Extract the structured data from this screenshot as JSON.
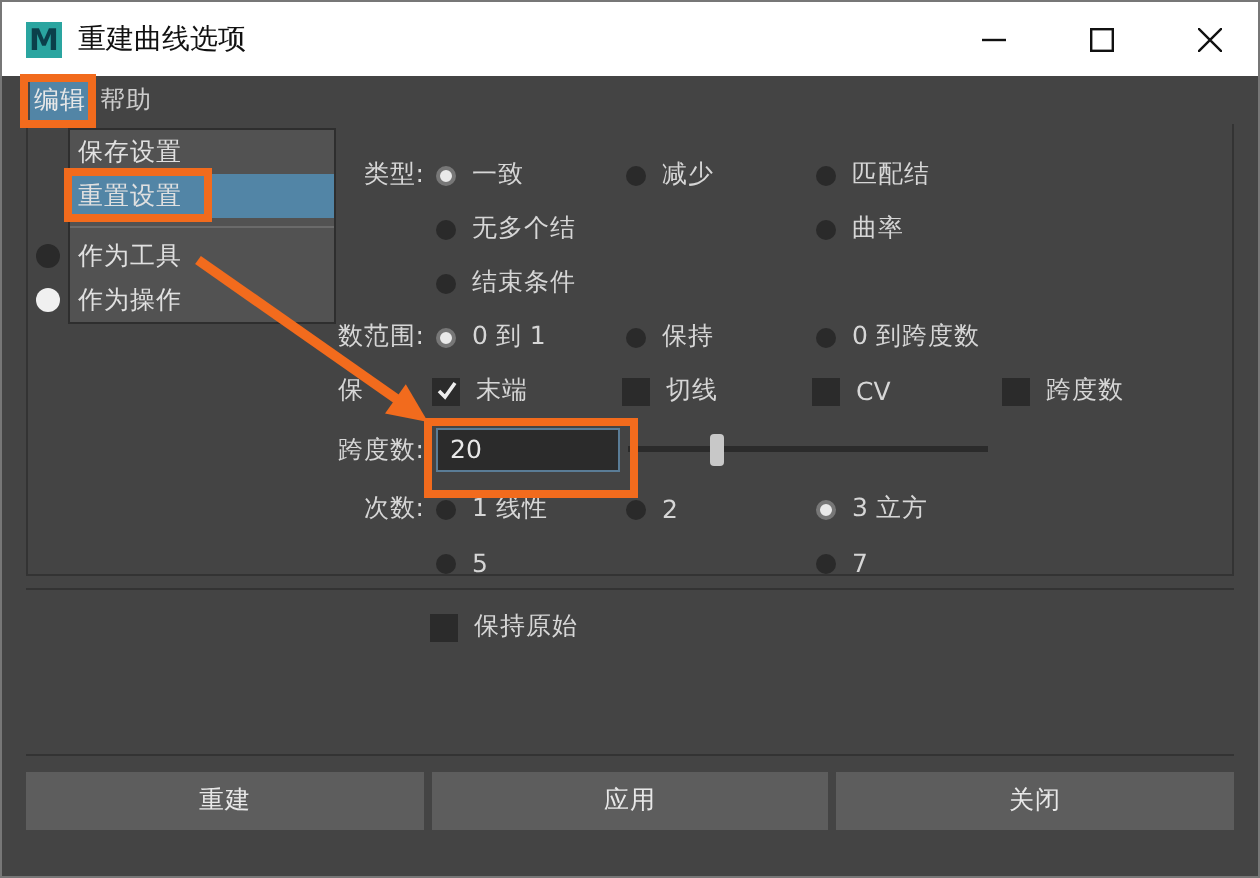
{
  "window": {
    "logo": "M",
    "title": "重建曲线选项"
  },
  "menu_bar": [
    {
      "label": "编辑",
      "selected": true
    },
    {
      "label": "帮助",
      "selected": false
    }
  ],
  "menu_dropdown": {
    "items": [
      {
        "kind": "item",
        "label": "保存设置",
        "selected": false
      },
      {
        "kind": "item",
        "label": "重置设置",
        "selected": true
      },
      {
        "kind": "separator"
      },
      {
        "kind": "radio",
        "label": "作为工具",
        "selected": false
      },
      {
        "kind": "radio",
        "label": "作为操作",
        "selected": true
      }
    ]
  },
  "form": {
    "rows": [
      {
        "kind": "radio",
        "label": "类型:",
        "columns": [
          [
            {
              "label": "一致",
              "selected": true
            },
            {
              "label": "无多个结",
              "selected": false
            },
            {
              "label": "结束条件",
              "selected": false
            }
          ],
          [
            {
              "label": "减少",
              "selected": false
            }
          ],
          [
            {
              "label": "匹配结",
              "selected": false
            },
            {
              "label": "曲率",
              "selected": false
            }
          ]
        ]
      },
      {
        "kind": "radio",
        "label": "数范围:",
        "columns": [
          [
            {
              "label": "0 到 1",
              "selected": true
            }
          ],
          [
            {
              "label": "保持",
              "selected": false
            }
          ],
          [
            {
              "label": "0 到跨度数",
              "selected": false
            }
          ]
        ]
      },
      {
        "kind": "check",
        "label": "保",
        "columns": [
          [
            {
              "label": "末端",
              "checked": true
            }
          ],
          [
            {
              "label": "切线",
              "checked": false
            }
          ],
          [
            {
              "label": "CV",
              "checked": false
            }
          ],
          [
            {
              "label": "跨度数",
              "checked": false
            }
          ]
        ]
      },
      {
        "kind": "slider",
        "label": "跨度数:",
        "value": "20",
        "level": 0.23
      },
      {
        "kind": "radio",
        "label": "次数:",
        "columns": [
          [
            {
              "label": "1 线性",
              "selected": false
            },
            {
              "label": "5",
              "selected": false
            }
          ],
          [
            {
              "label": "2",
              "selected": false
            }
          ],
          [
            {
              "label": "3 立方",
              "selected": true
            },
            {
              "label": "7",
              "selected": false
            }
          ]
        ]
      }
    ]
  },
  "keep_original": {
    "label": "保持原始",
    "checked": false
  },
  "buttons": [
    "重建",
    "应用",
    "关闭"
  ]
}
